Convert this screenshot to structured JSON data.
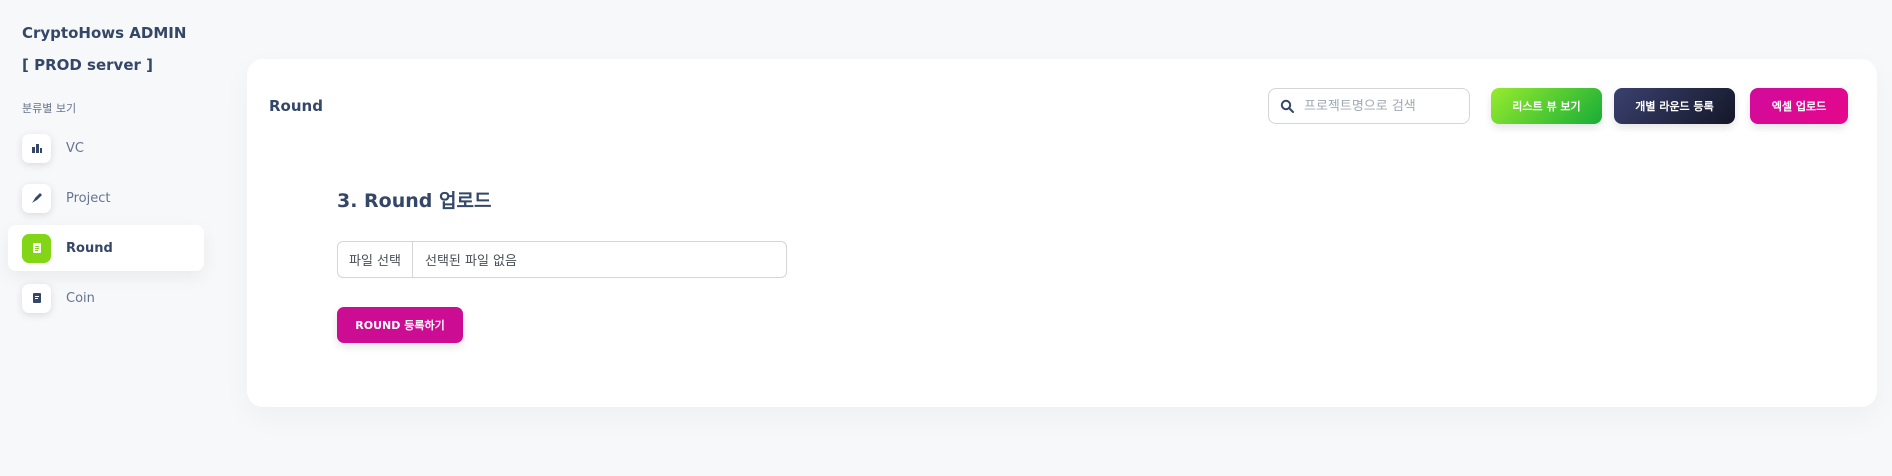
{
  "sidebar": {
    "brand": "CryptoHows ADMIN",
    "server": "[ PROD server ]",
    "section_label": "분류별 보기",
    "items": [
      {
        "label": "VC",
        "icon": "building-icon",
        "active": false
      },
      {
        "label": "Project",
        "icon": "rocket-icon",
        "active": false
      },
      {
        "label": "Round",
        "icon": "document-icon",
        "active": true
      },
      {
        "label": "Coin",
        "icon": "coin-icon",
        "active": false
      }
    ]
  },
  "header": {
    "title": "Round",
    "search_placeholder": "프로젝트명으로 검색",
    "buttons": {
      "list_view": "리스트 뷰 보기",
      "single_round": "개별 라운드 등록",
      "excel_upload": "엑셀 업로드"
    }
  },
  "main": {
    "upload_title": "3. Round 업로드",
    "file_button": "파일 선택",
    "file_status": "선택된 파일 없음",
    "submit_label": "ROUND 등록하기"
  },
  "colors": {
    "accent_green": "#82d616",
    "accent_dark": "#1f2340",
    "accent_pink": "#e5088a",
    "submit_pink": "#cc0d93"
  }
}
